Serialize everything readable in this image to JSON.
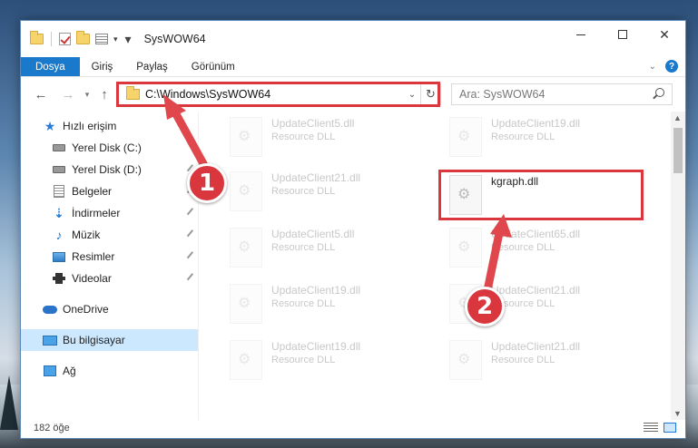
{
  "window": {
    "title": "SysWOW64"
  },
  "ribbon": {
    "tabs": [
      "Dosya",
      "Giriş",
      "Paylaş",
      "Görünüm"
    ]
  },
  "address": {
    "path": "C:\\Windows\\SysWOW64"
  },
  "search": {
    "placeholder": "Ara: SysWOW64"
  },
  "sidebar": {
    "quick_access": "Hızlı erişim",
    "items": [
      {
        "label": "Yerel Disk (C:)",
        "icon": "drive-icon",
        "pinned": false
      },
      {
        "label": "Yerel Disk (D:)",
        "icon": "drive-icon",
        "pinned": true
      },
      {
        "label": "Belgeler",
        "icon": "documents-icon",
        "pinned": true
      },
      {
        "label": "İndirmeler",
        "icon": "download-icon",
        "pinned": true
      },
      {
        "label": "Müzik",
        "icon": "music-icon",
        "pinned": true
      },
      {
        "label": "Resimler",
        "icon": "pictures-icon",
        "pinned": true
      },
      {
        "label": "Videolar",
        "icon": "video-icon",
        "pinned": true
      }
    ],
    "onedrive": "OneDrive",
    "this_pc": "Bu bilgisayar",
    "network": "Ağ"
  },
  "files": [
    {
      "name": "UpdateClient5.dll",
      "type": "Resource DLL"
    },
    {
      "name": "UpdateClient19.dll",
      "type": "Resource DLL"
    },
    {
      "name": "UpdateClient21.dll",
      "type": "Resource DLL"
    },
    {
      "name": "kgraph.dll",
      "type": ""
    },
    {
      "name": "UpdateClient5.dll",
      "type": "Resource DLL"
    },
    {
      "name": "UpdateClient65.dll",
      "type": "Resource DLL"
    },
    {
      "name": "UpdateClient19.dll",
      "type": "Resource DLL"
    },
    {
      "name": "UpdateClient21.dll",
      "type": "Resource DLL"
    },
    {
      "name": "UpdateClient19.dll",
      "type": "Resource DLL"
    },
    {
      "name": "UpdateClient21.dll",
      "type": "Resource DLL"
    }
  ],
  "status": {
    "count": "182 öğe"
  },
  "badges": [
    "1",
    "2"
  ],
  "colors": {
    "accent": "#1979ca",
    "highlight": "#d9363e",
    "selected_nav": "#cce8ff"
  }
}
